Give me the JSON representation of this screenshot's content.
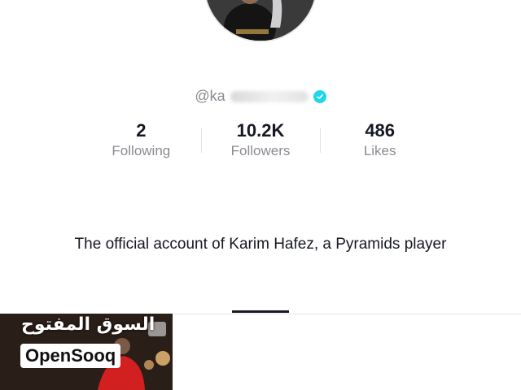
{
  "profile": {
    "username": "@ka",
    "bio": "The official account of Karim Hafez, a Pyramids player"
  },
  "stats": [
    {
      "value": "2",
      "label": "Following"
    },
    {
      "value": "10.2K",
      "label": "Followers"
    },
    {
      "value": "486",
      "label": "Likes"
    }
  ],
  "watermark": {
    "arabic": "السوق المفتوح",
    "english": "OpenSooq"
  },
  "colors": {
    "verified": "#20d5ec",
    "secondary_text": "#8a8b91",
    "primary_text": "#161823"
  }
}
